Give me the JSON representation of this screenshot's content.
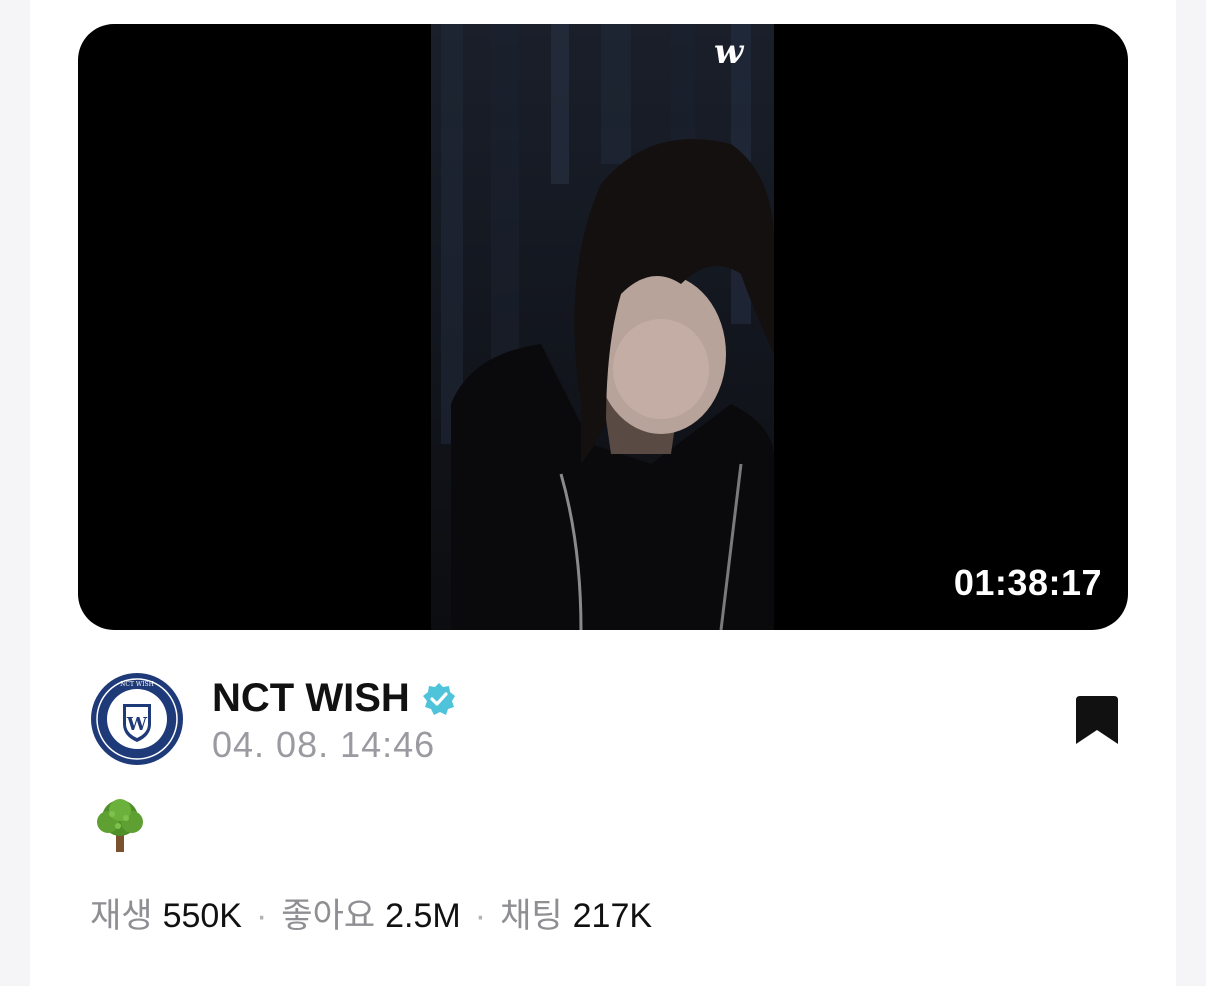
{
  "video": {
    "watermark": "w",
    "duration": "01:38:17"
  },
  "channel": {
    "name": "NCT WISH",
    "verified": true,
    "date": "04. 08. 14:46",
    "logo_text": "NCT WISH"
  },
  "post": {
    "emoji": "🌳",
    "emoji_icon": "tree-icon"
  },
  "stats": {
    "play_label": "재생",
    "play_value": "550K",
    "like_label": "좋아요",
    "like_value": "2.5M",
    "chat_label": "채팅",
    "chat_value": "217K",
    "separator": "·"
  },
  "colors": {
    "verified": "#4fc3d9",
    "accent_text": "#111111",
    "muted_text": "#9a9aa0",
    "logo_navy": "#1e3a78"
  }
}
